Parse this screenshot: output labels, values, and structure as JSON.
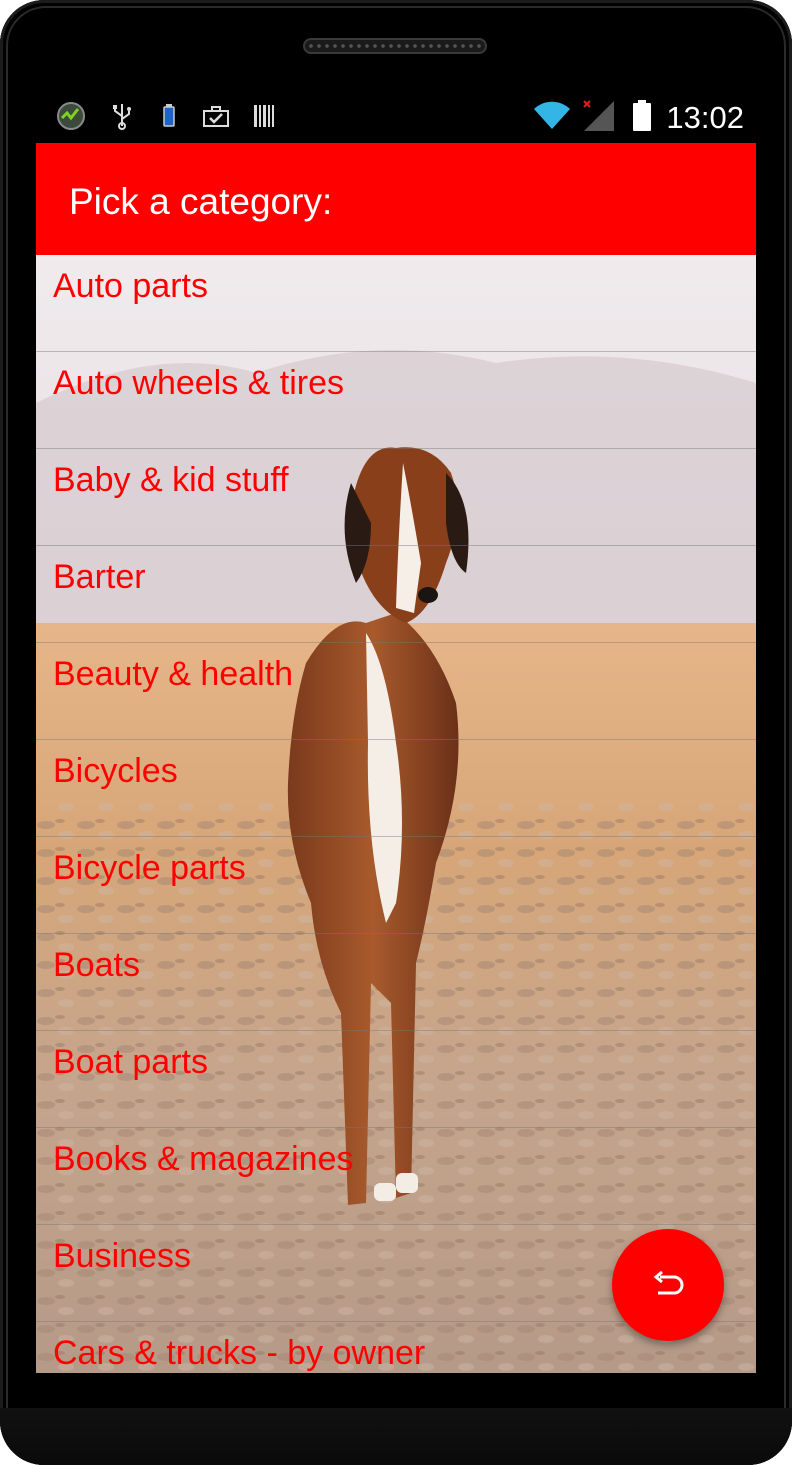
{
  "status_bar": {
    "time": "13:02",
    "left_icons": [
      "app-badge-icon",
      "usb-icon",
      "battery-small-icon",
      "briefcase-check-icon",
      "barcode-icon"
    ],
    "right_icons": [
      "wifi-icon",
      "no-signal-icon",
      "battery-icon"
    ]
  },
  "app_bar": {
    "title": "Pick a category:"
  },
  "categories": [
    "Auto parts",
    "Auto wheels & tires",
    "Baby & kid stuff",
    "Barter",
    "Beauty & health",
    "Bicycles",
    "Bicycle parts",
    "Boats",
    "Boat parts",
    "Books & magazines",
    "Business",
    "Cars & trucks - by owner"
  ],
  "fab": {
    "icon": "undo-icon"
  },
  "colors": {
    "accent": "#ff0000",
    "list_text": "#ff0000",
    "app_bar_text": "#ffffff"
  }
}
